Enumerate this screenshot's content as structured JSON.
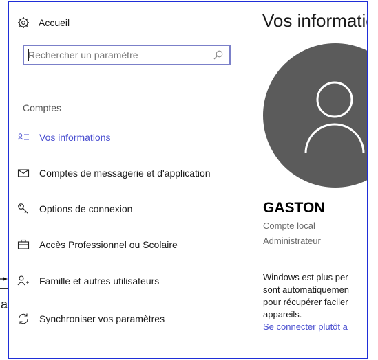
{
  "sidebar": {
    "home": {
      "label": "Accueil",
      "icon": "gear-icon"
    },
    "search": {
      "placeholder": "Rechercher un paramètre",
      "icon": "search-icon"
    },
    "section_title": "Comptes",
    "items": [
      {
        "label": "Vos informations",
        "icon": "person-card-icon",
        "active": true
      },
      {
        "label": "Comptes de messagerie et d'application",
        "icon": "mail-icon",
        "active": false
      },
      {
        "label": "Options de connexion",
        "icon": "key-icon",
        "active": false
      },
      {
        "label": "Accès Professionnel ou Scolaire",
        "icon": "briefcase-icon",
        "active": false
      },
      {
        "label": "Famille et autres utilisateurs",
        "icon": "add-person-icon",
        "active": false
      },
      {
        "label": "Synchroniser vos paramètres",
        "icon": "sync-icon",
        "active": false
      }
    ]
  },
  "main": {
    "title": "Vos informations",
    "user_name": "GASTON",
    "account_type": "Compte local",
    "account_role": "Administrateur",
    "info_lines": [
      "Windows est plus per",
      "sont automatiquemen",
      "pour récupérer faciler",
      "appareils."
    ],
    "connect_link": "Se connecter plutôt a"
  },
  "outside": {
    "letter": "a"
  },
  "colors": {
    "accent": "#4a4fd0",
    "frame_border": "#1f2ed8",
    "avatar_bg": "#5b5b5b"
  }
}
